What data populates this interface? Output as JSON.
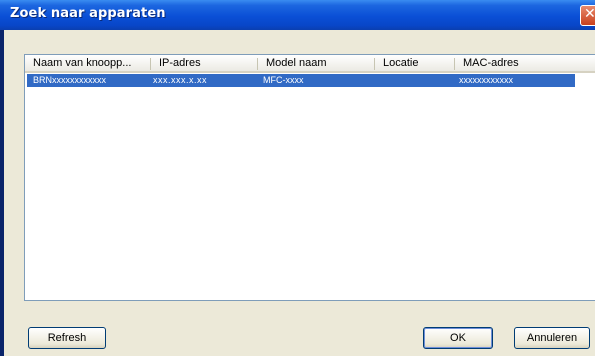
{
  "window": {
    "title": "Zoek naar apparaten",
    "close_icon": "close-icon"
  },
  "list": {
    "columns": [
      "Naam van knoopp...",
      "IP-adres",
      "Model naam",
      "Locatie",
      "MAC-adres"
    ],
    "rows": [
      {
        "name": "BRNxxxxxxxxxxxx",
        "ip": "xxx.xxx.x.xx",
        "model": "MFC-xxxx",
        "location": "",
        "mac": "xxxxxxxxxxxx",
        "selected": true
      }
    ]
  },
  "buttons": {
    "refresh": "Refresh",
    "ok": "OK",
    "cancel": "Annuleren"
  },
  "colors": {
    "titlebar": "#0a4fd6",
    "selection": "#316ac5",
    "dialog_bg": "#ece9d8"
  }
}
